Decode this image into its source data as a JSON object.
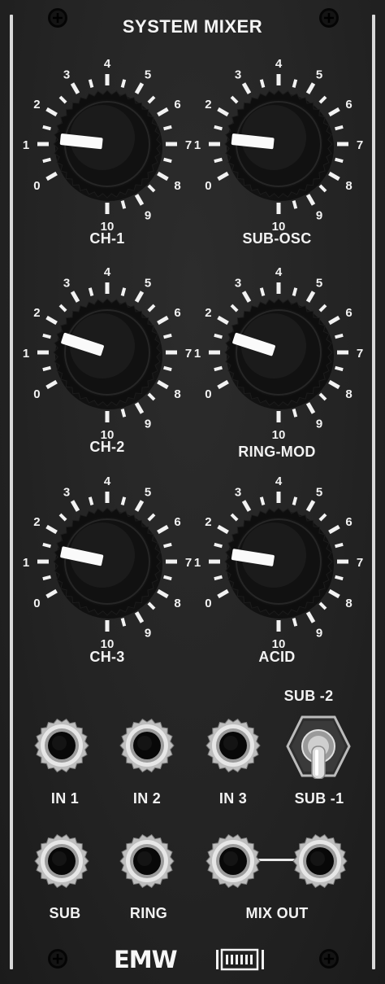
{
  "panel": {
    "title": "SYSTEM MIXER",
    "brand": "EMW",
    "accent_color": "#f2f2f2",
    "background_color": "#242424"
  },
  "scale_labels": [
    "0",
    "1",
    "2",
    "3",
    "4",
    "5",
    "6",
    "7",
    "8",
    "9",
    "10"
  ],
  "knobs": [
    {
      "id": "ch1",
      "label": "CH-1",
      "value": 1.2
    },
    {
      "id": "subosc",
      "label": "SUB-OSC",
      "value": 1.2
    },
    {
      "id": "ch2",
      "label": "CH-2",
      "value": 1.6
    },
    {
      "id": "ringmod",
      "label": "RING-MOD",
      "value": 1.6
    },
    {
      "id": "ch3",
      "label": "CH-3",
      "value": 1.4
    },
    {
      "id": "acid",
      "label": "ACID",
      "value": 1.3
    }
  ],
  "toggle": {
    "label_top": "SUB -2",
    "label_bottom": "SUB -1",
    "position": "down"
  },
  "jacks": {
    "in1": "IN 1",
    "in2": "IN 2",
    "in3": "IN 3",
    "sub": "SUB",
    "ring": "RING",
    "mix_out": "MIX OUT"
  },
  "icons": [
    "screw-icon",
    "toggle-switch-icon",
    "jack-icon",
    "logo-barcode-icon"
  ]
}
